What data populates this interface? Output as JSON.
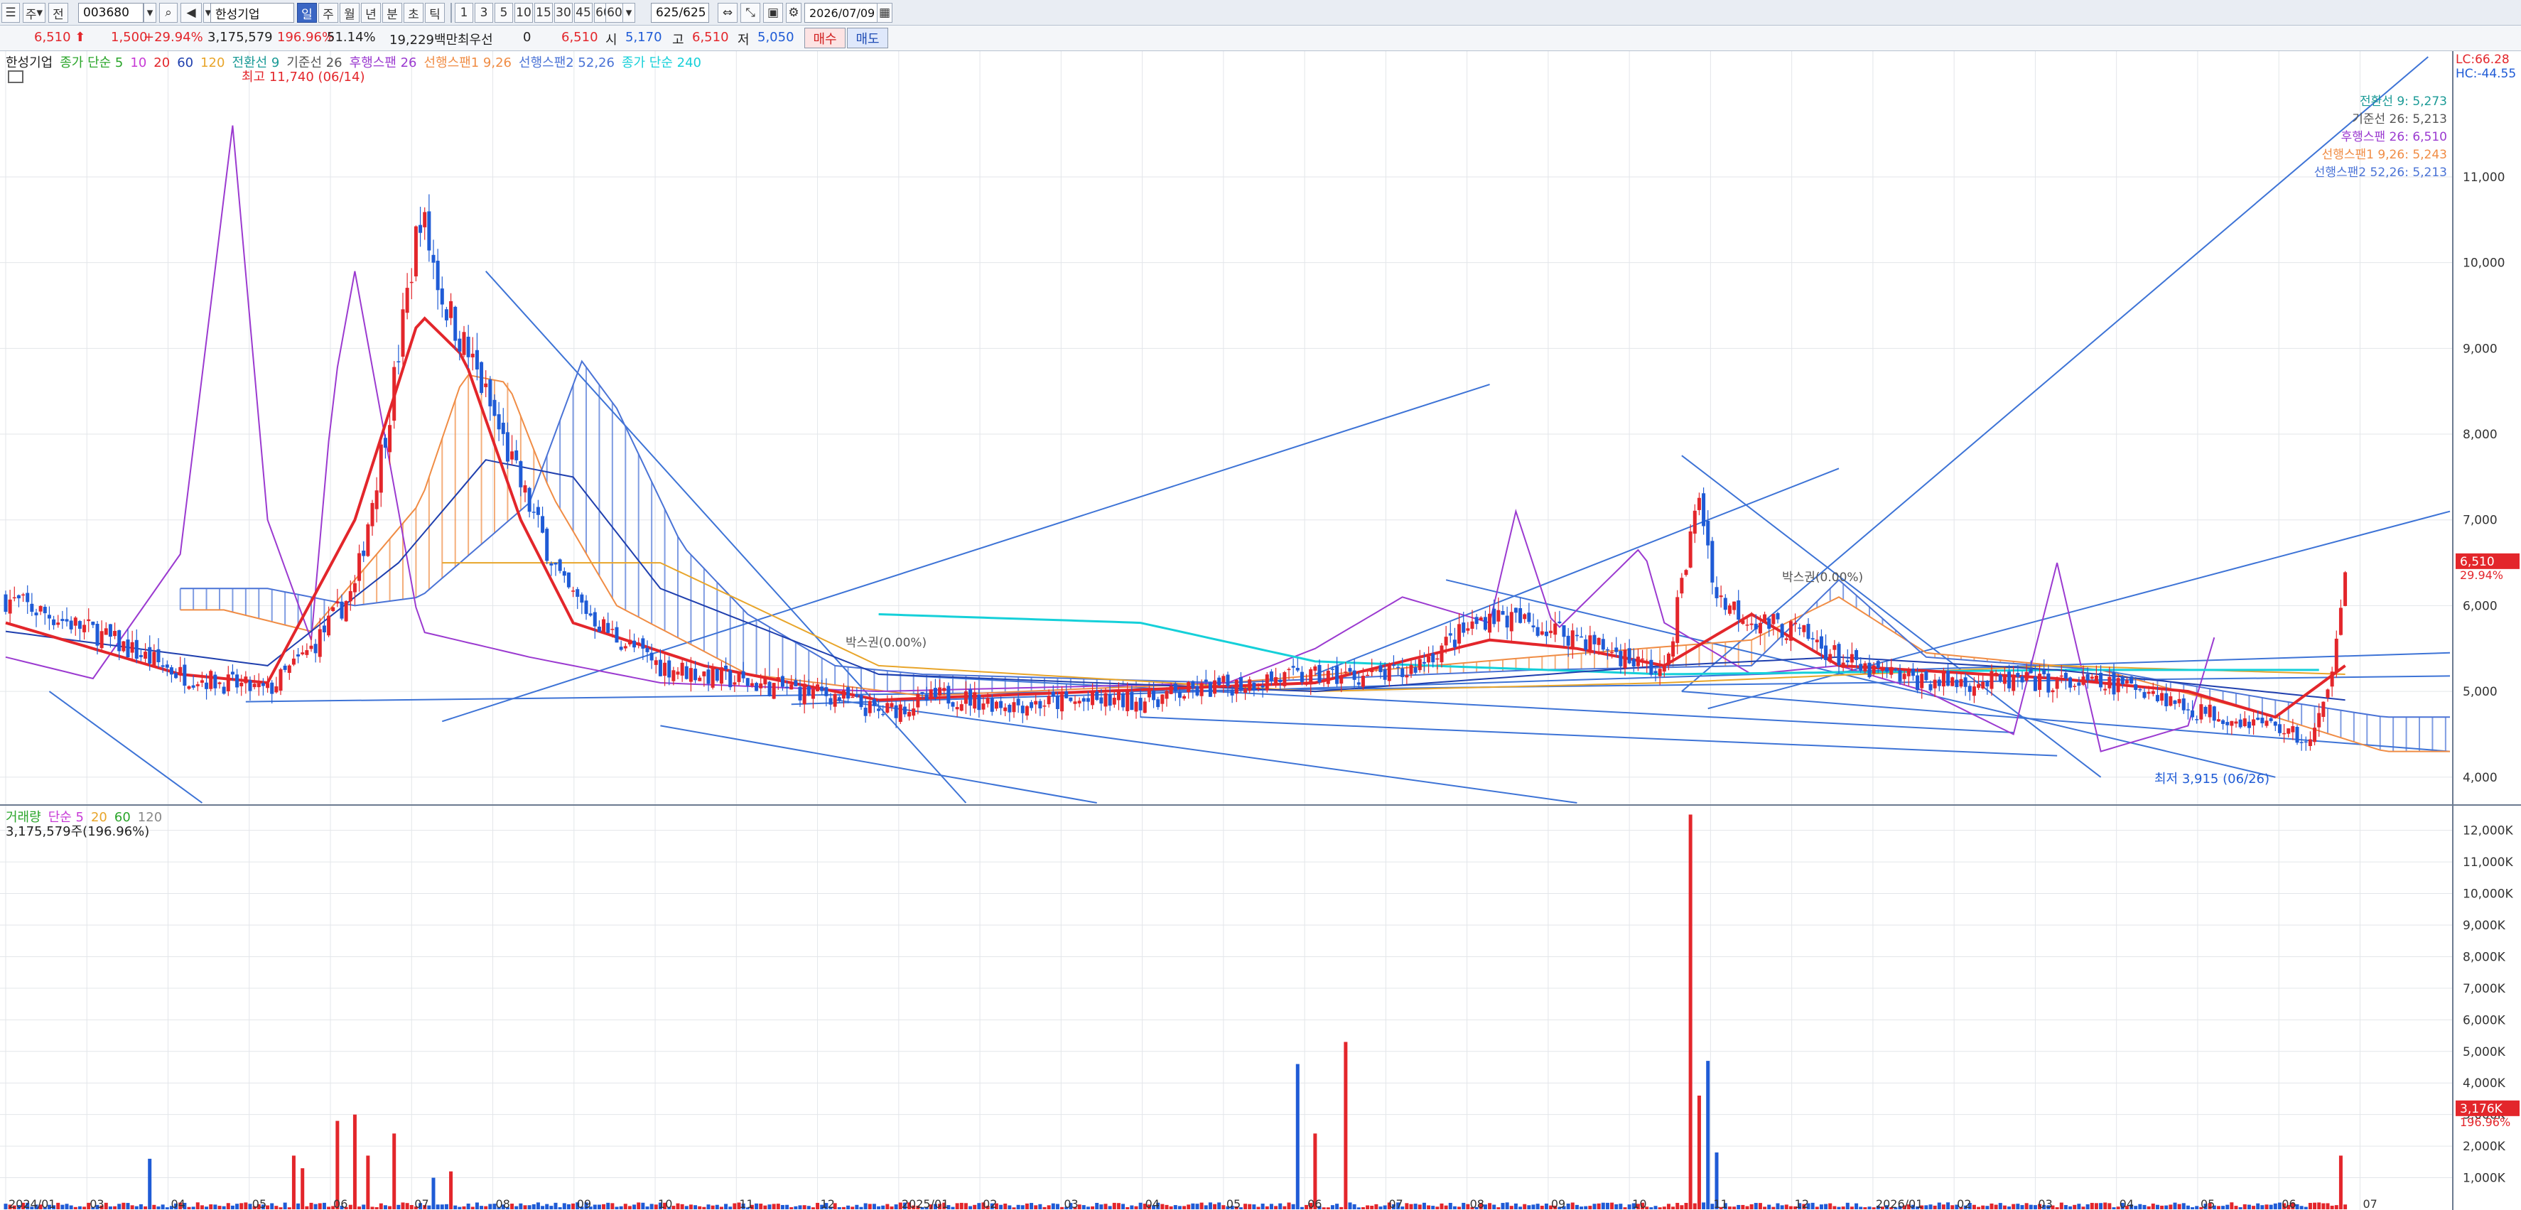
{
  "toolbar": {
    "period_select": "주",
    "view_select": "전",
    "stock_code": "003680",
    "stock_name": "한성기업",
    "timeframes": [
      "일",
      "주",
      "월",
      "년",
      "분",
      "초",
      "틱"
    ],
    "active_timeframe": "일",
    "intervals": [
      "1",
      "3",
      "5",
      "10",
      "15",
      "30",
      "45",
      "60"
    ],
    "interval_select": "60",
    "count": "625/625",
    "date": "2026/07/09"
  },
  "quote": {
    "price": "6,510",
    "change": "1,500",
    "change_pct": "+29.94%",
    "volume": "3,175,579",
    "volume_ratio": "196.96%",
    "foreign_ratio": "51.14%",
    "amount": "19,229백만",
    "preferred_label": "최우선",
    "preferred_value": "0",
    "cur": "6,510",
    "open_label": "시",
    "open": "5,170",
    "high_label": "고",
    "high": "6,510",
    "low_label": "저",
    "low": "5,050",
    "buy_label": "매수",
    "sell_label": "매도"
  },
  "colors": {
    "up": "#e3262b",
    "down": "#1f5bd6",
    "ma5": "#2aa52a",
    "ma10": "#c73ad6",
    "ma20": "#e3262b",
    "ma60": "#1f3fae",
    "ma120": "#e8a52a",
    "ma240": "#15d0d9",
    "conv": "#1a9a96",
    "base": "#555555",
    "lag": "#9b3ad0",
    "spanA": "#f08c44",
    "spanB": "#4a73d6",
    "volume": "#1f5bd6"
  },
  "price_legend": [
    {
      "text": "한성기업",
      "color": "#222222"
    },
    {
      "text": "종가 단순 5",
      "color": "#2aa52a"
    },
    {
      "text": "10",
      "color": "#c73ad6"
    },
    {
      "text": "20",
      "color": "#e3262b"
    },
    {
      "text": "60",
      "color": "#1f3fae"
    },
    {
      "text": "120",
      "color": "#e8a52a"
    },
    {
      "text": "전환선 9",
      "color": "#1a9a96"
    },
    {
      "text": "기준선 26",
      "color": "#555555"
    },
    {
      "text": "후행스팬 26",
      "color": "#9b3ad0"
    },
    {
      "text": "선행스팬1 9,26",
      "color": "#f08c44"
    },
    {
      "text": "선행스팬2 52,26",
      "color": "#4a73d6"
    },
    {
      "text": "종가 단순 240",
      "color": "#15d0d9"
    }
  ],
  "volume_legend": [
    {
      "text": "거래량",
      "color": "#2aa52a"
    },
    {
      "text": "단순 5",
      "color": "#c73ad6"
    },
    {
      "text": "20",
      "color": "#e8a52a"
    },
    {
      "text": "60",
      "color": "#2aa52a"
    },
    {
      "text": "120",
      "color": "#888888"
    }
  ],
  "volume_subtitle": "3,175,579주(196.96%)",
  "ichimoku_values": [
    {
      "text": "전환선 9: 5,273",
      "color": "#1a9a96"
    },
    {
      "text": "기준선 26: 5,213",
      "color": "#555555"
    },
    {
      "text": "후행스팬 26: 6,510",
      "color": "#9b3ad0"
    },
    {
      "text": "선행스팬1 9,26: 5,243",
      "color": "#f08c44"
    },
    {
      "text": "선행스팬2 52,26: 5,213",
      "color": "#4a73d6"
    }
  ],
  "lc_label": "LC:66.28",
  "hc_label": "HC:-44.55",
  "annotations": {
    "high": "최고 11,740 (06/14)",
    "low": "최저 3,915 (06/26)",
    "box1": "박스권(0.00%)",
    "box2": "박스권(0.00%)"
  },
  "chart_data": [
    {
      "type": "candlestick",
      "title": "한성기업",
      "ylim": [
        3700,
        12400
      ],
      "y_ticks": [
        4000,
        5000,
        6000,
        7000,
        8000,
        9000,
        10000,
        11000
      ],
      "y_tick_labels": [
        "4,000",
        "5,000",
        "6,000",
        "7,000",
        "8,000",
        "9,000",
        "10,000",
        "11,000"
      ],
      "x_labels": [
        "2024/01",
        "03",
        "04",
        "05",
        "06",
        "07",
        "08",
        "09",
        "10",
        "11",
        "12",
        "2025/01",
        "02",
        "03",
        "04",
        "05",
        "06",
        "07",
        "08",
        "09",
        "10",
        "11",
        "12",
        "2026/01",
        "02",
        "03",
        "04",
        "05",
        "06",
        "07"
      ],
      "last_price": "6,510",
      "last_change": "29.94%",
      "close_keypoints": [
        [
          0,
          6080
        ],
        [
          20,
          5700
        ],
        [
          40,
          5200
        ],
        [
          60,
          5000
        ],
        [
          70,
          5500
        ],
        [
          80,
          6200
        ],
        [
          88,
          8300
        ],
        [
          95,
          10600
        ],
        [
          100,
          9600
        ],
        [
          108,
          8700
        ],
        [
          118,
          7400
        ],
        [
          128,
          6200
        ],
        [
          138,
          5700
        ],
        [
          150,
          5300
        ],
        [
          170,
          5100
        ],
        [
          190,
          4950
        ],
        [
          200,
          4750
        ],
        [
          215,
          4950
        ],
        [
          230,
          4850
        ],
        [
          260,
          4900
        ],
        [
          290,
          5150
        ],
        [
          320,
          5200
        ],
        [
          340,
          5900
        ],
        [
          360,
          5650
        ],
        [
          380,
          5200
        ],
        [
          388,
          7300
        ],
        [
          392,
          6100
        ],
        [
          400,
          5850
        ],
        [
          410,
          5700
        ],
        [
          425,
          5250
        ],
        [
          440,
          5120
        ],
        [
          470,
          5100
        ],
        [
          490,
          5050
        ],
        [
          500,
          4800
        ],
        [
          520,
          4600
        ],
        [
          528,
          4400
        ],
        [
          532,
          4950
        ],
        [
          536,
          6510
        ]
      ],
      "ma_keypoints": {
        "ma20": [
          [
            0,
            5800
          ],
          [
            40,
            5200
          ],
          [
            60,
            5100
          ],
          [
            80,
            7000
          ],
          [
            95,
            9400
          ],
          [
            105,
            8900
          ],
          [
            118,
            7000
          ],
          [
            130,
            5800
          ],
          [
            160,
            5300
          ],
          [
            200,
            4900
          ],
          [
            300,
            5100
          ],
          [
            340,
            5600
          ],
          [
            360,
            5500
          ],
          [
            380,
            5300
          ],
          [
            400,
            5900
          ],
          [
            420,
            5300
          ],
          [
            470,
            5150
          ],
          [
            500,
            5000
          ],
          [
            520,
            4700
          ],
          [
            536,
            5300
          ]
        ],
        "ma60": [
          [
            0,
            5700
          ],
          [
            60,
            5300
          ],
          [
            90,
            6500
          ],
          [
            110,
            7700
          ],
          [
            130,
            7500
          ],
          [
            150,
            6200
          ],
          [
            200,
            5200
          ],
          [
            300,
            5000
          ],
          [
            380,
            5300
          ],
          [
            420,
            5400
          ],
          [
            470,
            5250
          ],
          [
            536,
            4900
          ]
        ],
        "ma120": [
          [
            100,
            6500
          ],
          [
            150,
            6500
          ],
          [
            200,
            5300
          ],
          [
            300,
            5000
          ],
          [
            380,
            5100
          ],
          [
            470,
            5300
          ],
          [
            536,
            5200
          ]
        ],
        "ma240": [
          [
            200,
            5900
          ],
          [
            260,
            5800
          ],
          [
            300,
            5350
          ],
          [
            380,
            5200
          ],
          [
            470,
            5250
          ],
          [
            530,
            5250
          ]
        ]
      },
      "span_keypoints": {
        "spanA": [
          [
            50,
            5950
          ],
          [
            70,
            5700
          ],
          [
            95,
            7200
          ],
          [
            105,
            8700
          ],
          [
            115,
            8600
          ],
          [
            125,
            7300
          ],
          [
            140,
            6000
          ],
          [
            170,
            5200
          ],
          [
            210,
            4950
          ],
          [
            280,
            5100
          ],
          [
            350,
            5400
          ],
          [
            400,
            5600
          ],
          [
            420,
            6100
          ],
          [
            440,
            5450
          ],
          [
            480,
            5250
          ],
          [
            520,
            4700
          ],
          [
            545,
            4300
          ]
        ],
        "spanB": [
          [
            60,
            6200
          ],
          [
            80,
            6000
          ],
          [
            95,
            6100
          ],
          [
            120,
            7200
          ],
          [
            132,
            8850
          ],
          [
            140,
            8300
          ],
          [
            155,
            6700
          ],
          [
            170,
            5900
          ],
          [
            190,
            5300
          ],
          [
            210,
            5200
          ],
          [
            280,
            5100
          ],
          [
            350,
            5250
          ],
          [
            400,
            5300
          ],
          [
            420,
            6300
          ],
          [
            440,
            5400
          ],
          [
            480,
            5250
          ],
          [
            520,
            4900
          ],
          [
            545,
            4700
          ]
        ]
      },
      "lag_keypoints": [
        [
          0,
          5400
        ],
        [
          20,
          5150
        ],
        [
          40,
          6600
        ],
        [
          52,
          11600
        ],
        [
          60,
          7000
        ],
        [
          70,
          5600
        ],
        [
          75,
          8500
        ],
        [
          80,
          9900
        ],
        [
          95,
          5700
        ],
        [
          120,
          5400
        ],
        [
          150,
          5100
        ],
        [
          200,
          5000
        ],
        [
          280,
          5100
        ],
        [
          300,
          5500
        ],
        [
          320,
          6100
        ],
        [
          340,
          5800
        ],
        [
          346,
          7100
        ],
        [
          355,
          5700
        ],
        [
          375,
          6700
        ],
        [
          380,
          5800
        ],
        [
          400,
          5200
        ],
        [
          420,
          5300
        ],
        [
          440,
          5000
        ],
        [
          460,
          4500
        ],
        [
          470,
          6500
        ],
        [
          480,
          4300
        ],
        [
          500,
          4600
        ],
        [
          507,
          5800
        ]
      ]
    },
    {
      "type": "bar",
      "title": "거래량",
      "ylim": [
        0,
        12600
      ],
      "unit": "K",
      "y_ticks": [
        1000,
        2000,
        3000,
        4000,
        5000,
        6000,
        7000,
        8000,
        9000,
        10000,
        11000,
        12000
      ],
      "y_tick_labels": [
        "1,000K",
        "2,000K",
        "3,000K",
        "4,000K",
        "5,000K",
        "6,000K",
        "7,000K",
        "8,000K",
        "9,000K",
        "10,000K",
        "11,000K",
        "12,000K"
      ],
      "last_volume": "3,176K",
      "last_ratio": "196.96%",
      "spikes": [
        [
          33,
          1600
        ],
        [
          66,
          1700
        ],
        [
          68,
          1300
        ],
        [
          76,
          2800
        ],
        [
          80,
          3000
        ],
        [
          83,
          1700
        ],
        [
          89,
          2400
        ],
        [
          98,
          1000
        ],
        [
          102,
          1200
        ],
        [
          296,
          4600
        ],
        [
          300,
          2400
        ],
        [
          307,
          5300
        ],
        [
          386,
          12500
        ],
        [
          388,
          3600
        ],
        [
          390,
          4700
        ],
        [
          392,
          1800
        ],
        [
          535,
          1700
        ],
        [
          537,
          3176
        ]
      ]
    }
  ]
}
